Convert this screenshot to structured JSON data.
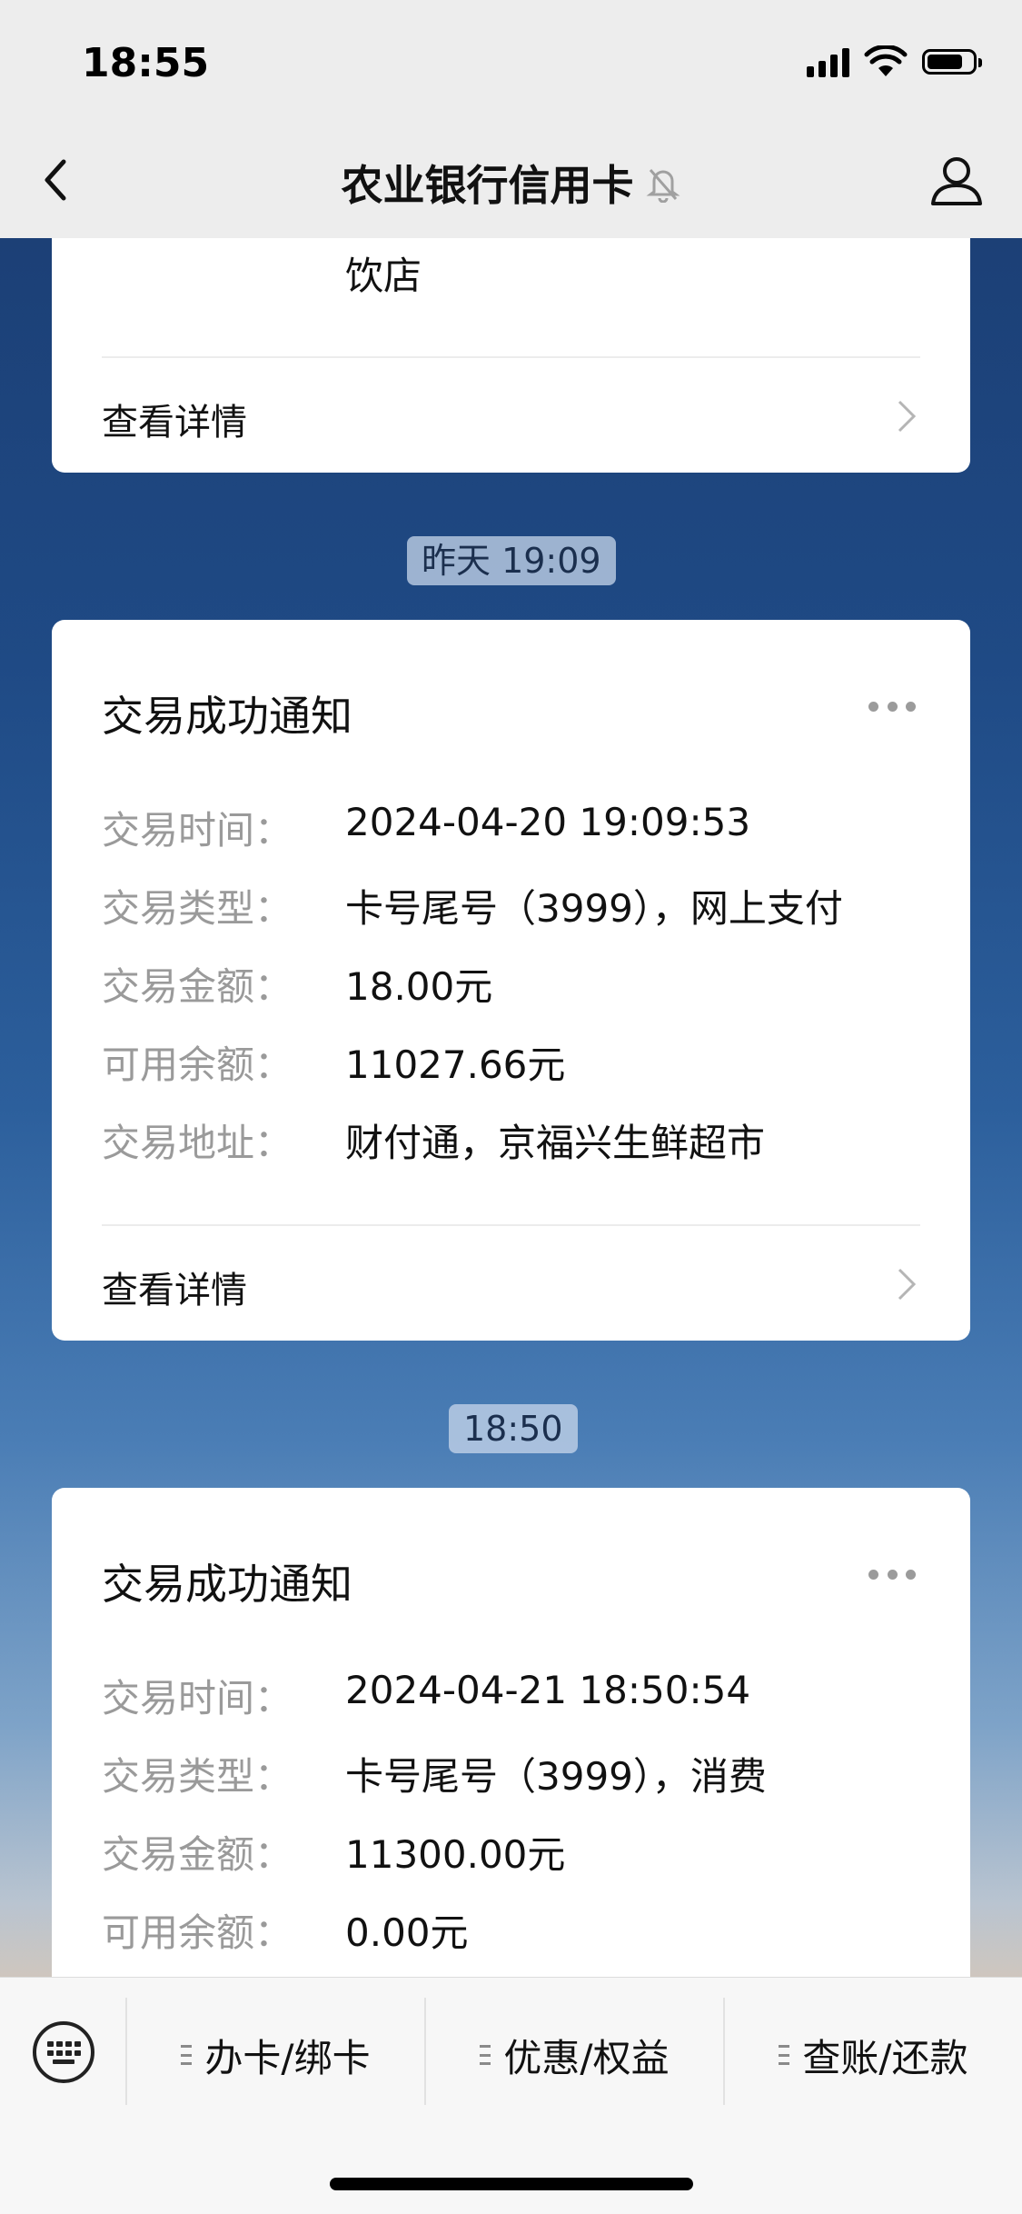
{
  "status_bar": {
    "time": "18:55"
  },
  "nav": {
    "title": "农业银行信用卡"
  },
  "top_card": {
    "partial_value": "饮店",
    "detail_label": "查看详情"
  },
  "messages": [
    {
      "timestamp": "昨天 19:09",
      "title": "交易成功通知",
      "rows": [
        {
          "label": "交易时间：",
          "value": "2024-04-20 19:09:53"
        },
        {
          "label": "交易类型：",
          "value": "卡号尾号（3999），网上支付"
        },
        {
          "label": "交易金额：",
          "value": "18.00元"
        },
        {
          "label": "可用余额：",
          "value": "11027.66元"
        },
        {
          "label": "交易地址：",
          "value": "财付通，京福兴生鲜超市"
        }
      ],
      "detail_label": "查看详情"
    },
    {
      "timestamp": "18:50",
      "title": "交易成功通知",
      "rows": [
        {
          "label": "交易时间：",
          "value": "2024-04-21 18:50:54"
        },
        {
          "label": "交易类型：",
          "value": "卡号尾号（3999），消费"
        },
        {
          "label": "交易金额：",
          "value": "11300.00元"
        },
        {
          "label": "可用余额：",
          "value": "0.00元"
        }
      ]
    }
  ],
  "bottom_menu": {
    "items": [
      {
        "label": "办卡/绑卡"
      },
      {
        "label": "优惠/权益"
      },
      {
        "label": "查账/还款"
      }
    ]
  }
}
